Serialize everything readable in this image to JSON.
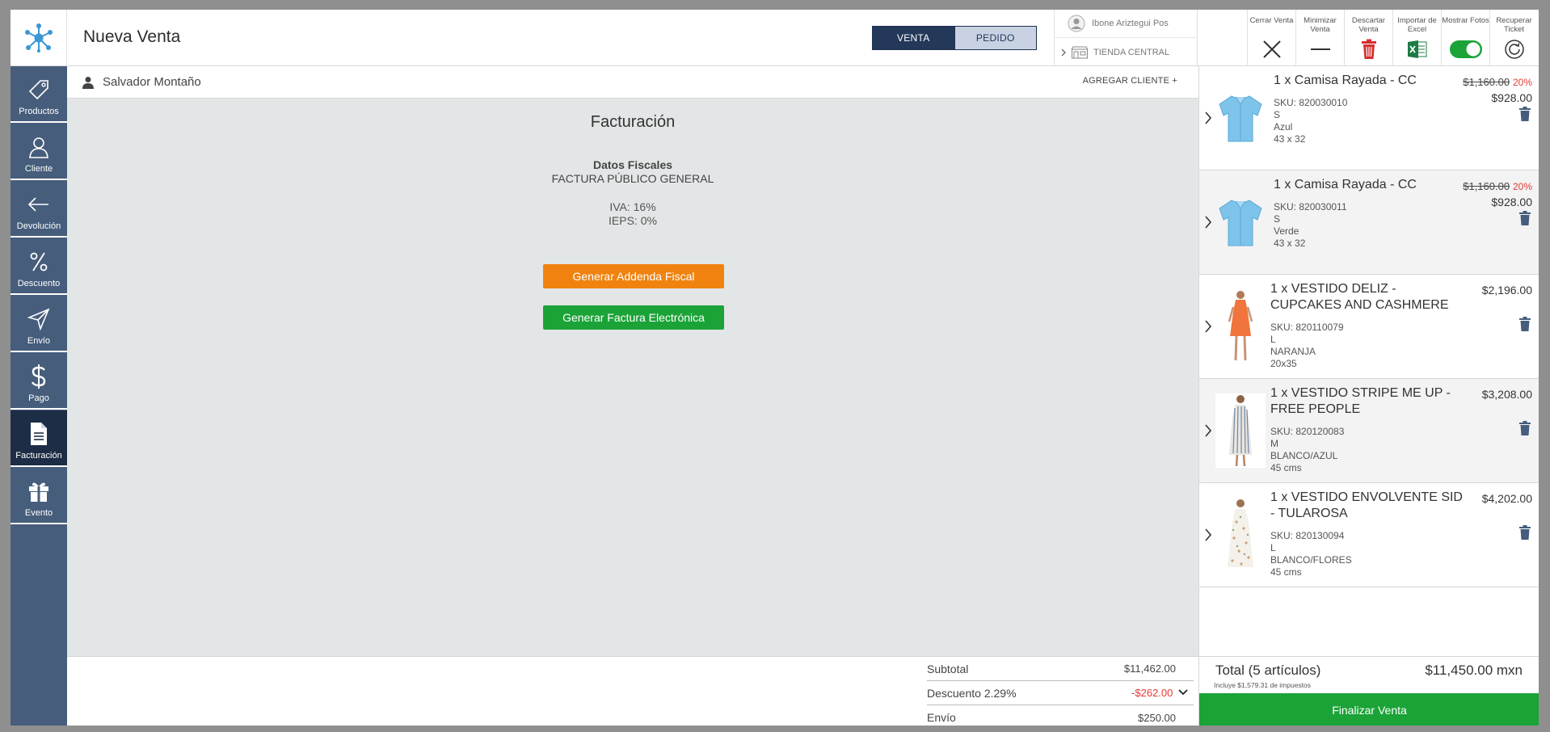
{
  "header": {
    "title": "Nueva Venta",
    "mode_tabs": [
      "VENTA",
      "PEDIDO"
    ],
    "user": "Ibone Ariztegui Pos",
    "store": "TIENDA CENTRAL",
    "tools": [
      {
        "label": "Cerrar Venta",
        "icon": "close-icon"
      },
      {
        "label": "Minimizar Venta",
        "icon": "minimize-icon"
      },
      {
        "label": "Descartar Venta",
        "icon": "trash-icon"
      },
      {
        "label": "Importar de Excel",
        "icon": "excel-icon"
      },
      {
        "label": "Mostrar Fotos",
        "icon": "toggle-icon"
      },
      {
        "label": "Recuperar Ticket",
        "icon": "refresh-icon"
      }
    ]
  },
  "sidebar": {
    "items": [
      {
        "label": "Productos",
        "icon": "tag-icon"
      },
      {
        "label": "Cliente",
        "icon": "user-icon"
      },
      {
        "label": "Devolución",
        "icon": "arrow-left-icon"
      },
      {
        "label": "Descuento",
        "icon": "percent-icon"
      },
      {
        "label": "Envío",
        "icon": "send-icon"
      },
      {
        "label": "Pago",
        "icon": "dollar-icon"
      },
      {
        "label": "Facturación",
        "icon": "document-icon"
      },
      {
        "label": "Evento",
        "icon": "gift-icon"
      }
    ],
    "active": "Facturación"
  },
  "client": {
    "name": "Salvador Montaño",
    "add_label": "AGREGAR CLIENTE +"
  },
  "billing": {
    "title": "Facturación",
    "fiscal_heading": "Datos Fiscales",
    "fiscal_name": "FACTURA PÚBLICO GENERAL",
    "iva": "IVA: 16%",
    "ieps": "IEPS: 0%",
    "addenda_button": "Generar Addenda Fiscal",
    "invoice_button": "Generar Factura Electrónica"
  },
  "summary": {
    "subtotal_label": "Subtotal",
    "subtotal_value": "$11,462.00",
    "discount_label": "Descuento 2.29%",
    "discount_value": "-$262.00",
    "shipping_label": "Envío",
    "shipping_value": "$250.00"
  },
  "cart": {
    "items": [
      {
        "title": "1 x Camisa Rayada - CC",
        "sku": "SKU: 820030010",
        "size": "S",
        "color": "Azul",
        "measure": "43 x 32",
        "old_price": "$1,160.00",
        "discount": "20%",
        "price": "$928.00"
      },
      {
        "title": "1 x Camisa Rayada - CC",
        "sku": "SKU: 820030011",
        "size": "S",
        "color": "Verde",
        "measure": "43 x 32",
        "old_price": "$1,160.00",
        "discount": "20%",
        "price": "$928.00"
      },
      {
        "title": "1 x VESTIDO DELIZ - CUPCAKES AND CASHMERE",
        "sku": "SKU: 820110079",
        "size": "L",
        "color": "NARANJA",
        "measure": "20x35",
        "price": "$2,196.00"
      },
      {
        "title": "1 x VESTIDO STRIPE ME UP - FREE PEOPLE",
        "sku": "SKU: 820120083",
        "size": "M",
        "color": "BLANCO/AZUL",
        "measure": "45 cms",
        "price": "$3,208.00"
      },
      {
        "title": "1 x VESTIDO ENVOLVENTE SID - TULAROSA",
        "sku": "SKU: 820130094",
        "size": "L",
        "color": "BLANCO/FLORES",
        "measure": "45 cms",
        "price": "$4,202.00"
      }
    ],
    "total_label": "Total (5 artículos)",
    "total_value": "$11,450.00 mxn",
    "tax_note": "Incluye $1,579.31 de impuestos",
    "finish_button": "Finalizar Venta"
  },
  "colors": {
    "rail": "#465d7c",
    "rail_active": "#1d2d45",
    "orange": "#f0830f",
    "green": "#1ba338",
    "discount_red": "#e53935"
  }
}
